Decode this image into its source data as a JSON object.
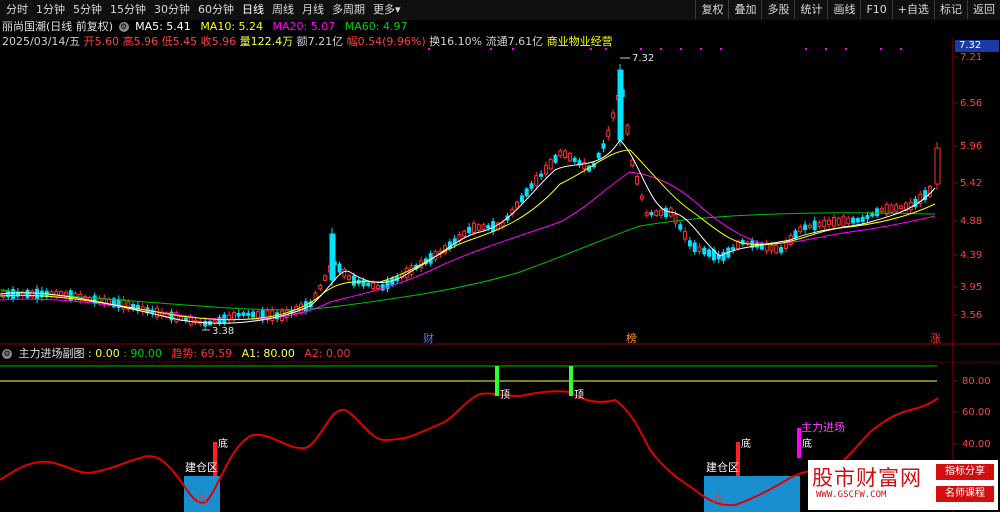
{
  "toolbar": {
    "periods": [
      "分时",
      "1分钟",
      "5分钟",
      "15分钟",
      "30分钟",
      "60分钟",
      "日线",
      "周线",
      "月线",
      "多周期",
      "更多"
    ],
    "active_period": "日线",
    "more_suffix": "▾",
    "right_buttons": [
      "复权",
      "叠加",
      "多股",
      "统计",
      "画线",
      "F10",
      "+自选",
      "标记",
      "返回"
    ]
  },
  "info": {
    "stock_name": "丽尚国潮(日线 前复权)",
    "ma5": "MA5: 5.41",
    "ma10": "MA10: 5.24",
    "ma20": "MA20: 5.07",
    "ma60": "MA60: 4.97",
    "date": "2025/03/14/五",
    "open": "开5.60",
    "high": "高5.96",
    "low": "低5.45",
    "close": "收5.96",
    "volume": "量122.4万",
    "amount": "额7.21亿",
    "change": "幅0.54(9.96%)",
    "turnover": "换16.10%",
    "float_cap": "流通7.61亿",
    "sector": "商业物业经营"
  },
  "price_axis": [
    "7.21",
    "6.56",
    "5.96",
    "5.42",
    "4.88",
    "4.39",
    "3.95",
    "3.56"
  ],
  "current_price": "7.32",
  "peak_label": "7.32",
  "low_label": "3.38",
  "event_labels": {
    "cai": "财",
    "bang": "榜",
    "zhang": "涨"
  },
  "sub_panel": {
    "title": "主力进场副图",
    "v1": ": 0.00",
    "v2": ": 90.00",
    "trend": "趋势: 69.59",
    "a1": "A1: 80.00",
    "a2": "A2: 0.00",
    "axis": [
      "80.00",
      "60.00",
      "40.00"
    ],
    "labels": {
      "ding": "顶",
      "di": "底",
      "jiancang": "建仓区",
      "zhuli": "主力进场"
    }
  },
  "watermark": {
    "title": "股市财富网",
    "url": "WWW.GSCFW.COM",
    "tag1": "指标分享",
    "tag2": "名师课程"
  },
  "colors": {
    "up": "#ff3030",
    "down": "#00ffff",
    "ma5": "#ffffff",
    "ma10": "#ffff00",
    "ma20": "#ff00ff",
    "ma60": "#00c000",
    "trend": "#e00000",
    "zone": "#1a8fcf"
  },
  "chart_data": {
    "type": "candlestick",
    "ylim": [
      3.3,
      7.4
    ],
    "ma_last": {
      "ma5": 5.41,
      "ma10": 5.24,
      "ma20": 5.07,
      "ma60": 4.97
    },
    "last_candle": {
      "open": 5.6,
      "high": 5.96,
      "low": 5.45,
      "close": 5.96
    },
    "sub_ylim": [
      0,
      100
    ],
    "sub_lines": {
      "top": 90,
      "a1": 80
    }
  }
}
